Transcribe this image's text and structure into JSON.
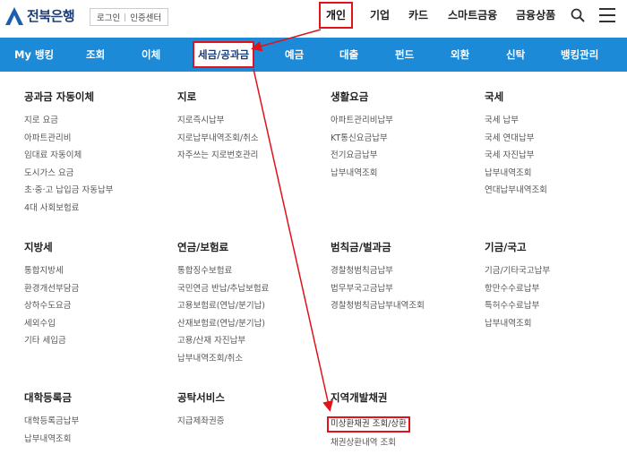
{
  "brand": {
    "name": "전북은행"
  },
  "util": {
    "login": "로그인",
    "cert": "인증센터"
  },
  "gnb": [
    "개인",
    "기업",
    "카드",
    "스마트금융",
    "금융상품"
  ],
  "nav": [
    "My 뱅킹",
    "조회",
    "이체",
    "세금/공과금",
    "예금",
    "대출",
    "펀드",
    "외환",
    "신탁",
    "뱅킹관리"
  ],
  "groups": [
    {
      "title": "공과금 자동이체",
      "links": [
        "지로 요금",
        "아파트관리비",
        "임대료 자동이체",
        "도시가스 요금",
        "초·중·고 납입금 자동납부",
        "4대 사회보험료"
      ]
    },
    {
      "title": "지로",
      "links": [
        "지로즉시납부",
        "지로납부내역조회/취소",
        "자주쓰는 지로번호관리"
      ]
    },
    {
      "title": "생활요금",
      "links": [
        "아파트관리비납부",
        "KT통신요금납부",
        "전기요금납부",
        "납부내역조회"
      ]
    },
    {
      "title": "국세",
      "links": [
        "국세 납부",
        "국세 연대납부",
        "국세 자진납부",
        "납부내역조회",
        "연대납부내역조회"
      ]
    },
    {
      "title": "지방세",
      "links": [
        "통합지방세",
        "환경개선부담금",
        "상하수도요금",
        "세외수입",
        "기타 세입금"
      ]
    },
    {
      "title": "연금/보험료",
      "links": [
        "통합징수보험료",
        "국민연금 반납/추납보험료",
        "고용보험료(연납/분기납)",
        "산재보험료(연납/분기납)",
        "고용/산재 자진납부",
        "납부내역조회/취소"
      ]
    },
    {
      "title": "범칙금/벌과금",
      "links": [
        "경찰청범칙금납부",
        "법무부국고금납부",
        "경찰청범칙금납부내역조회"
      ]
    },
    {
      "title": "기금/국고",
      "links": [
        "기금/기타국고납부",
        "항만수수료납부",
        "특허수수료납부",
        "납부내역조회"
      ]
    },
    {
      "title": "대학등록금",
      "links": [
        "대학등록금납부",
        "납부내역조회"
      ]
    },
    {
      "title": "공탁서비스",
      "links": [
        "지급제좌권증"
      ]
    },
    {
      "title": "지역개발채권",
      "links": [
        "미상환채권 조회/상환",
        "채권상환내역 조회"
      ]
    }
  ],
  "colors": {
    "nav_blue": "#1d8ad8",
    "highlight_red": "#e0121a",
    "brand_blue": "#1b5eae"
  }
}
